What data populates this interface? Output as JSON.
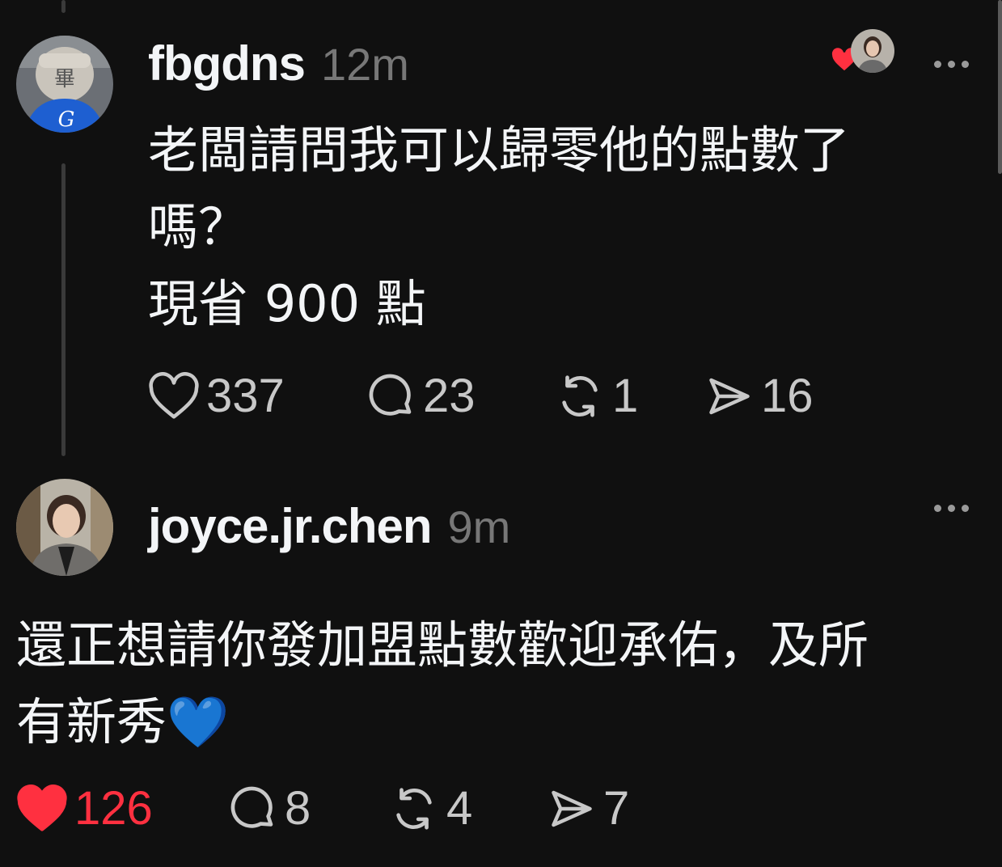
{
  "post": {
    "username": "fbgdns",
    "time": "12m",
    "text_line1": "老闆請問我可以歸零他的點數了",
    "text_line2": "嗎？",
    "text_line3": "現省 900 點",
    "likes": "337",
    "comments": "23",
    "reposts": "1",
    "shares": "16",
    "avatar_letter": "G"
  },
  "reply": {
    "username": "joyce.jr.chen",
    "time": "9m",
    "text_line1": "還正想請你發加盟點數歡迎承佑，及所",
    "text_line2": "有新秀💙",
    "likes": "126",
    "comments": "8",
    "reposts": "4",
    "shares": "7",
    "liked": true
  },
  "colors": {
    "background": "#101010",
    "text": "#f3f5f7",
    "muted": "#777777",
    "like_red": "#ff3040"
  },
  "icons": [
    "heart-icon",
    "comment-icon",
    "repost-icon",
    "share-icon",
    "more-options-icon"
  ]
}
